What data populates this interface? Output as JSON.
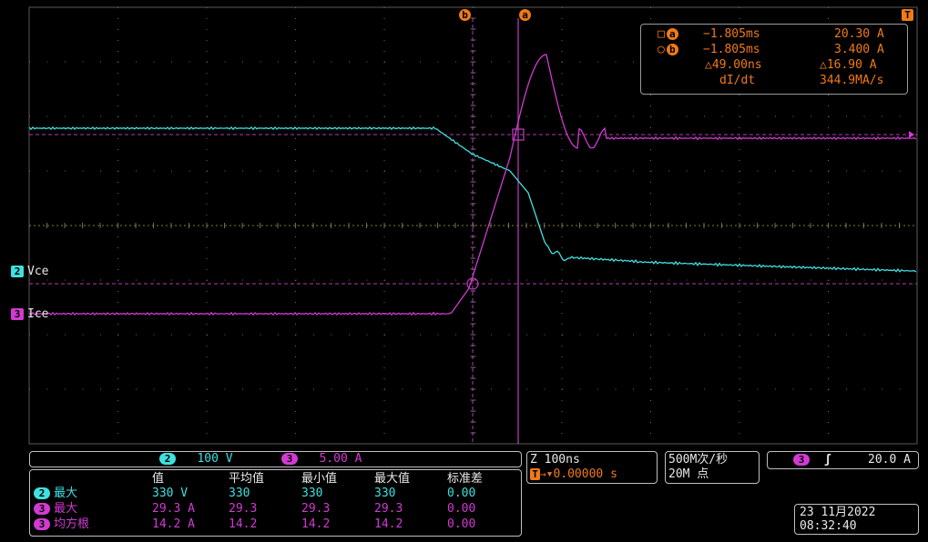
{
  "markers": {
    "cursor_b": "b",
    "cursor_a": "a",
    "trigger": "T"
  },
  "cursor_readout": {
    "a_time": "−1.805ms",
    "a_value": "20.30 A",
    "b_time": "−1.805ms",
    "b_value": "3.400 A",
    "delta_time": "△49.00ns",
    "delta_value": "△16.90 A",
    "didt_label": "dI/dt",
    "didt_value": "344.9MA/s"
  },
  "channels": {
    "ch2": {
      "num": "2",
      "name": "Vce",
      "scale": "100 V",
      "color": "#3fe0e0"
    },
    "ch3": {
      "num": "3",
      "name": "Ice",
      "scale": "5.00 A",
      "color": "#d23ad2"
    }
  },
  "timebase": {
    "zoom": "Z 100ns",
    "offset": "▾0.00000 s",
    "trigger_icon": "T→"
  },
  "acquisition": {
    "rate": "500M次/秒",
    "points": "20M 点"
  },
  "trigger_box": {
    "source": "3",
    "slope": "ʃ",
    "level": "20.0 A"
  },
  "measurements": {
    "headers": [
      "值",
      "平均值",
      "最小值",
      "最大值",
      "标准差"
    ],
    "rows": [
      {
        "ch": "2",
        "label": "最大",
        "values": [
          "330 V",
          "330",
          "330",
          "330",
          "0.00"
        ],
        "color": "#3fe0e0"
      },
      {
        "ch": "3",
        "label": "最大",
        "values": [
          "29.3 A",
          "29.3",
          "29.3",
          "29.3",
          "0.00"
        ],
        "color": "#d23ad2"
      },
      {
        "ch": "3",
        "label": "均方根",
        "values": [
          "14.2 A",
          "14.2",
          "14.2",
          "14.2",
          "0.00"
        ],
        "color": "#d23ad2"
      }
    ]
  },
  "datetime": {
    "date": "23 11月2022",
    "time": "08:32:40"
  }
}
